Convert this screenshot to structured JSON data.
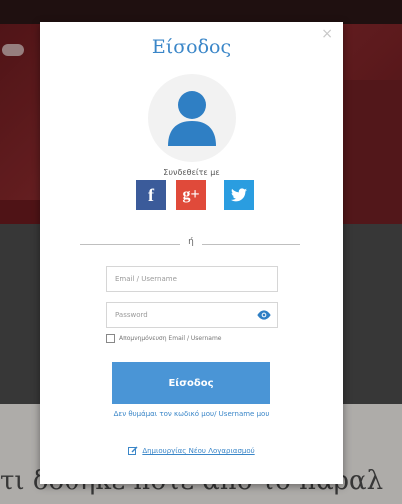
{
  "background": {
    "partial_text": "τι δοθηκε ποτε από το παραλ"
  },
  "modal": {
    "title": "Είσοδος",
    "close": "×",
    "connect_with": "Συνδεθείτε με",
    "social": {
      "facebook": "f",
      "google": "g+"
    },
    "divider": "ή",
    "email_placeholder": "Email / Username",
    "password_placeholder": "Password",
    "remember_me": "Απομνημόνευση Email / Username",
    "login_button": "Είσοδος",
    "forgot_link": "Δεν θυμάμαι τον κωδικό μου/ Username μου",
    "create_account": "Δημιουργίας Νέου Λογαριασμού"
  },
  "colors": {
    "accent": "#3a86c8",
    "facebook": "#3b5b9a",
    "google": "#e04a3a",
    "twitter": "#2a9de0",
    "button": "#4a95d6"
  },
  "icons": {
    "avatar": "user-silhouette-icon",
    "eye": "eye-icon",
    "create": "edit-icon",
    "twitter": "twitter-bird-icon"
  }
}
